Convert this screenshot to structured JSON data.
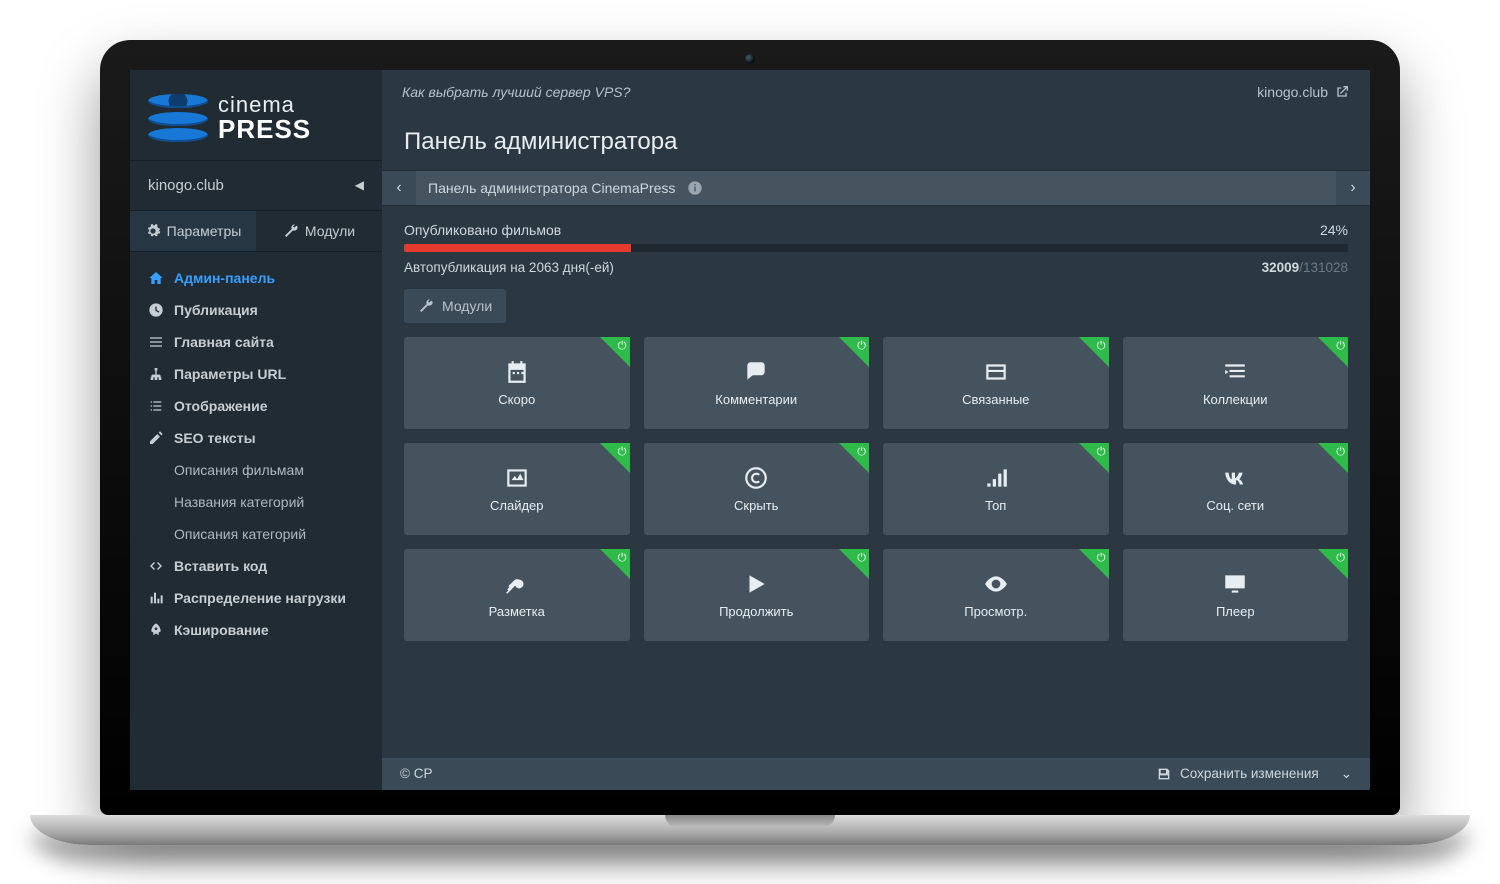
{
  "logo": {
    "line1": "cinema",
    "line2": "PRESS"
  },
  "topbar": {
    "hint": "Как выбрать лучший сервер VPS?",
    "domain": "kinogo.club"
  },
  "sidebar": {
    "site": "kinogo.club",
    "tabs": {
      "params": "Параметры",
      "modules": "Модули"
    },
    "nav": [
      {
        "label": "Админ-панель"
      },
      {
        "label": "Публикация"
      },
      {
        "label": "Главная сайта"
      },
      {
        "label": "Параметры URL"
      },
      {
        "label": "Отображение"
      },
      {
        "label": "SEO тексты"
      },
      {
        "label": "Описания фильмам"
      },
      {
        "label": "Названия категорий"
      },
      {
        "label": "Описания категорий"
      },
      {
        "label": "Вставить код"
      },
      {
        "label": "Распределение нагрузки"
      },
      {
        "label": "Кэширование"
      }
    ]
  },
  "page_title": "Панель администратора",
  "breadcrumb": "Панель администратора CinemaPress",
  "stats": {
    "label": "Опубликовано фильмов",
    "percent": "24%",
    "autoline": "Автопубликация на 2063 дня(-ей)",
    "count": "32009",
    "total": "/131028"
  },
  "modules_button": "Модули",
  "modules": [
    {
      "label": "Скоро"
    },
    {
      "label": "Комментарии"
    },
    {
      "label": "Связанные"
    },
    {
      "label": "Коллекции"
    },
    {
      "label": "Слайдер"
    },
    {
      "label": "Скрыть"
    },
    {
      "label": "Топ"
    },
    {
      "label": "Соц. сети"
    },
    {
      "label": "Разметка"
    },
    {
      "label": "Продолжить"
    },
    {
      "label": "Просмотр."
    },
    {
      "label": "Плеер"
    }
  ],
  "footer": {
    "copyright": "© CP",
    "save": "Сохранить изменения"
  }
}
